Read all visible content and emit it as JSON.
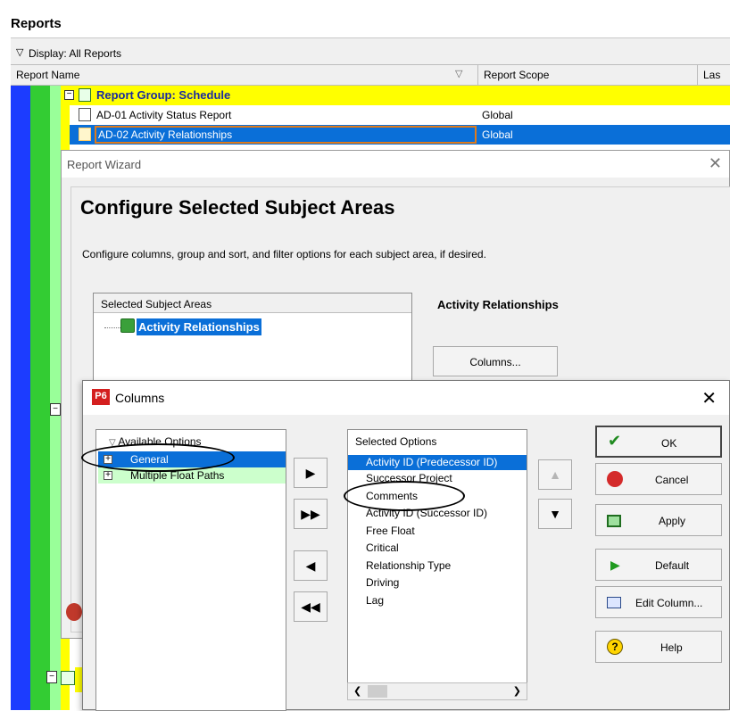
{
  "reports": {
    "title": "Reports",
    "display_label": "Display: All Reports",
    "columns": {
      "report_name": "Report Name",
      "report_scope": "Report Scope",
      "last": "Las"
    },
    "rows": [
      {
        "name": "Report Group: Schedule",
        "scope": ""
      },
      {
        "name": "AD-01 Activity Status Report",
        "scope": "Global"
      },
      {
        "name": "AD-02  Activity Relationships",
        "scope": "Global"
      }
    ]
  },
  "wizard": {
    "title": "Report Wizard",
    "heading": "Configure Selected Subject Areas",
    "description": "Configure columns, group and sort, and filter options for each subject area, if desired.",
    "subject_header": "Selected Subject Areas",
    "subject_item": "Activity Relationships",
    "right_title": "Activity Relationships",
    "columns_button": "Columns..."
  },
  "columns_dialog": {
    "badge": "P6",
    "title": "Columns",
    "available_header": "Available Options",
    "available_items": [
      "General",
      "Multiple Float Paths"
    ],
    "selected_header": "Selected Options",
    "selected_items": [
      "Activity ID  (Predecessor ID)",
      "Successor Project",
      "Comments",
      "Activity ID  (Successor ID)",
      "Free Float",
      "Critical",
      "Relationship Type",
      "Driving",
      "Lag"
    ],
    "buttons": {
      "ok": "OK",
      "cancel": "Cancel",
      "apply": "Apply",
      "default": "Default",
      "edit_column": "Edit Column...",
      "help": "Help"
    }
  },
  "colors": {
    "tree_blue": "#1c3cff",
    "tree_green": "#33cc33",
    "tree_lightgreen": "#99ff99",
    "tree_yellow": "#ffff00",
    "selection": "#0a6fd8",
    "avail_selected": "#0a6fd8",
    "avail_alt": "#ccffcc"
  }
}
